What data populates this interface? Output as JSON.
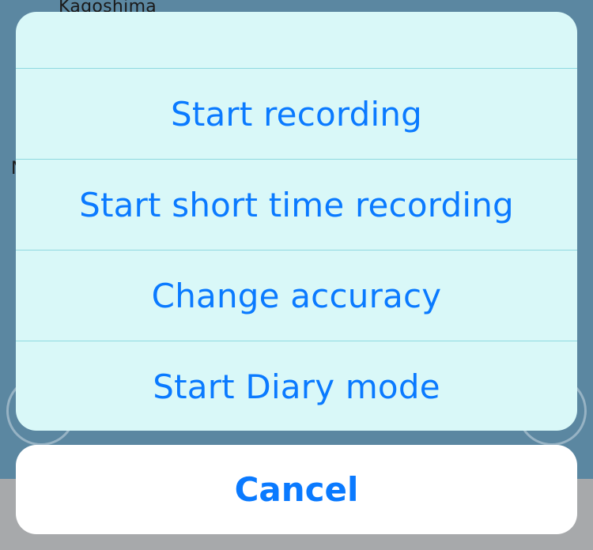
{
  "background": {
    "map_label_top": "Kagoshima",
    "map_label_left": "N"
  },
  "action_sheet": {
    "actions": [
      {
        "label": "Start recording"
      },
      {
        "label": "Start short time recording"
      },
      {
        "label": "Change accuracy"
      },
      {
        "label": "Start Diary mode"
      }
    ],
    "cancel_label": "Cancel"
  },
  "colors": {
    "accent": "#0a7aff",
    "sheet_bg": "#d9f8f8",
    "separator": "#8fd9e0",
    "backdrop": "#5b87a1"
  }
}
